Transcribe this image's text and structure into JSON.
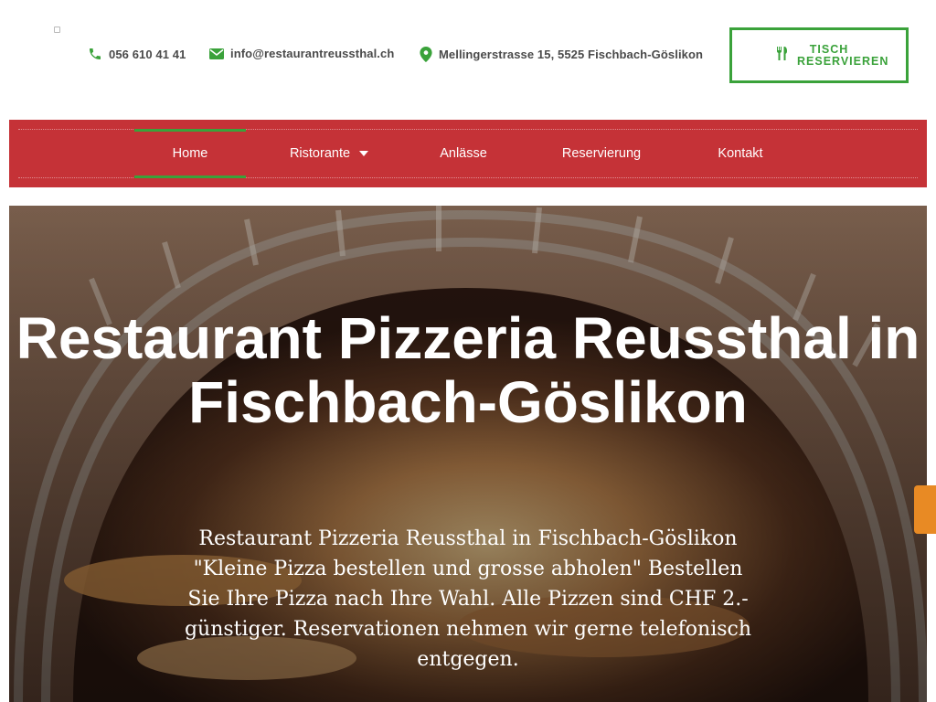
{
  "header": {
    "phone": "056 610 41 41",
    "email": "info@restaurantreussthal.ch",
    "address": "Mellingerstrasse 15, 5525 Fischbach-Göslikon",
    "reserve_button": "Tisch Reservieren",
    "icons": {
      "phone": "phone-icon",
      "email": "envelope-icon",
      "address": "map-pin-icon",
      "reserve": "cutlery-icon"
    }
  },
  "nav": {
    "items": [
      {
        "label": "Home",
        "active": true
      },
      {
        "label": "Ristorante",
        "has_dropdown": true
      },
      {
        "label": "Anlässe"
      },
      {
        "label": "Reservierung"
      },
      {
        "label": "Kontakt"
      }
    ]
  },
  "hero": {
    "title": "Restaurant Pizzeria Reussthal in Fischbach-Göslikon",
    "text": "Restaurant Pizzeria Reussthal in Fischbach-Göslikon \"Kleine Pizza bestellen und grosse abholen\" Bestellen Sie Ihre Pizza nach Ihre Wahl. Alle Pizzen sind CHF 2.- günstiger. Reservationen nehmen wir gerne telefonisch entgegen."
  },
  "colors": {
    "nav_red": "#c53237",
    "accent_green": "#3aa23a",
    "side_tab_orange": "#e88a24"
  }
}
